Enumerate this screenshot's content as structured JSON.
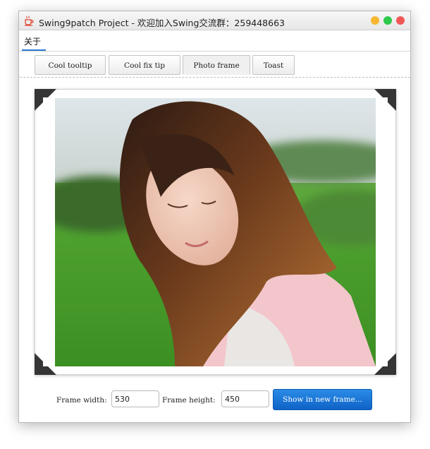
{
  "window": {
    "title": "Swing9patch Project - 欢迎加入Swing交流群：259448663"
  },
  "menu": {
    "items": [
      {
        "label": "关于"
      }
    ]
  },
  "tabs": [
    {
      "label": "Cool tooltip",
      "active": false
    },
    {
      "label": "Cool fix tip",
      "active": false
    },
    {
      "label": "Photo frame",
      "active": true
    },
    {
      "label": "Toast",
      "active": false
    }
  ],
  "controls": {
    "frame_width_label": "Frame width:",
    "frame_width_value": "530",
    "frame_height_label": "Frame height:",
    "frame_height_value": "450",
    "show_button_label": "Show in new frame..."
  },
  "colors": {
    "accent": "#1470d2",
    "menu_underline": "#2a7bd5"
  }
}
